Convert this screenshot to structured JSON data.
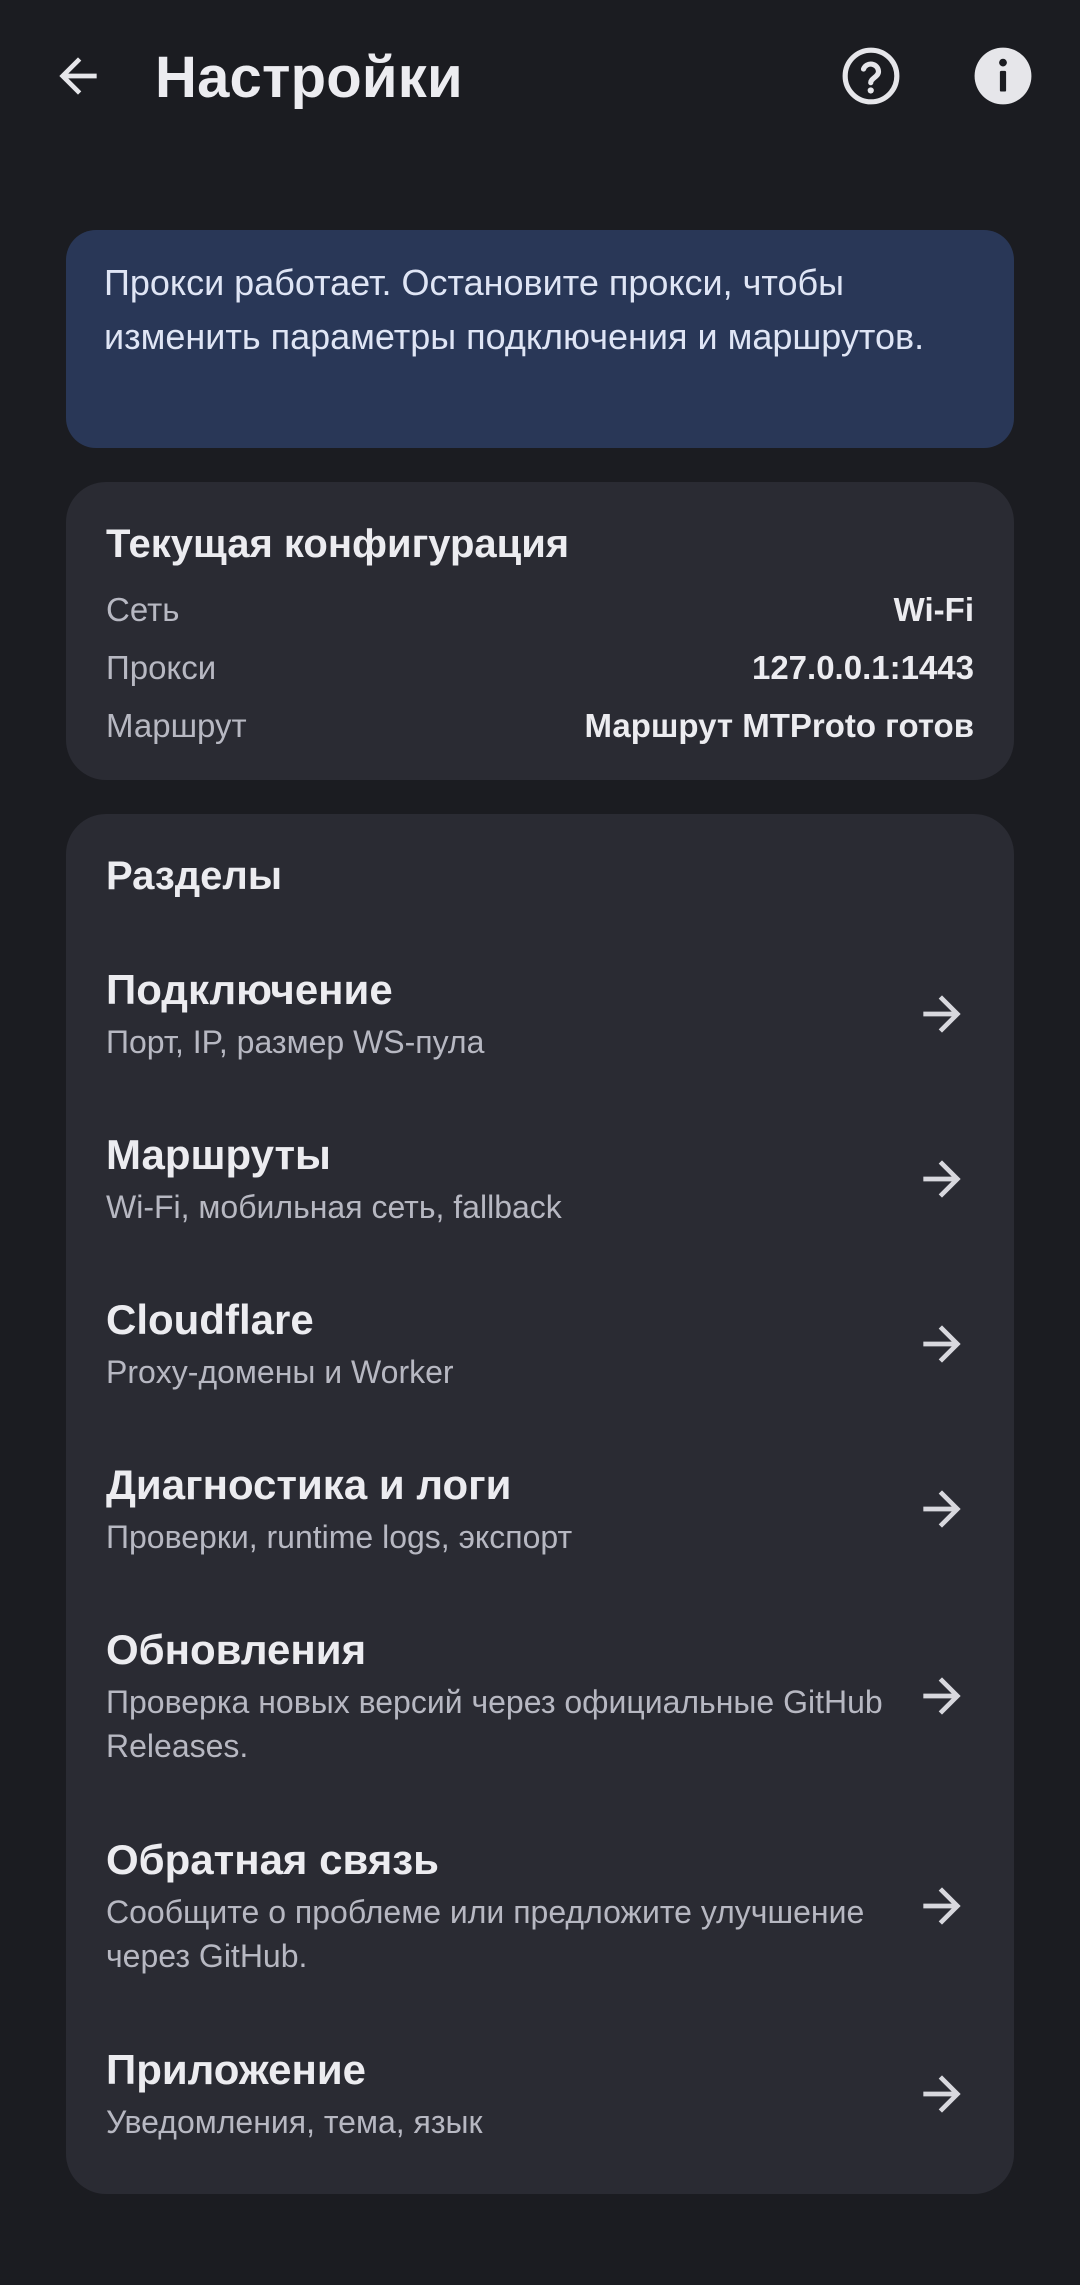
{
  "app_bar": {
    "title": "Настройки",
    "back_icon": "arrow-left-icon",
    "help_icon": "help-circle-icon",
    "info_icon": "info-circle-icon"
  },
  "banner": {
    "text": "Прокси работает. Остановите прокси, чтобы изменить параметры подключения и маршрутов."
  },
  "config": {
    "title": "Текущая конфигурация",
    "rows": [
      {
        "label": "Сеть",
        "value": "Wi-Fi"
      },
      {
        "label": "Прокси",
        "value": "127.0.0.1:1443"
      },
      {
        "label": "Маршрут",
        "value": "Маршрут MTProto готов"
      }
    ]
  },
  "sections": {
    "title": "Разделы",
    "items": [
      {
        "title": "Подключение",
        "subtitle": "Порт, IP, размер WS-пула"
      },
      {
        "title": "Маршруты",
        "subtitle": "Wi-Fi, мобильная сеть, fallback"
      },
      {
        "title": "Cloudflare",
        "subtitle": "Proxy-домены и Worker"
      },
      {
        "title": "Диагностика и логи",
        "subtitle": "Проверки, runtime logs, экспорт"
      },
      {
        "title": "Обновления",
        "subtitle": "Проверка новых версий через официальные GitHub Releases."
      },
      {
        "title": "Обратная связь",
        "subtitle": "Сообщите о проблеме или предложите улучшение через GitHub."
      },
      {
        "title": "Приложение",
        "subtitle": "Уведомления, тема, язык"
      }
    ]
  },
  "colors": {
    "background": "#1b1c21",
    "card": "#2a2b33",
    "banner": "#293757",
    "text_primary": "#ececf0",
    "text_secondary": "#b7b8c2"
  }
}
